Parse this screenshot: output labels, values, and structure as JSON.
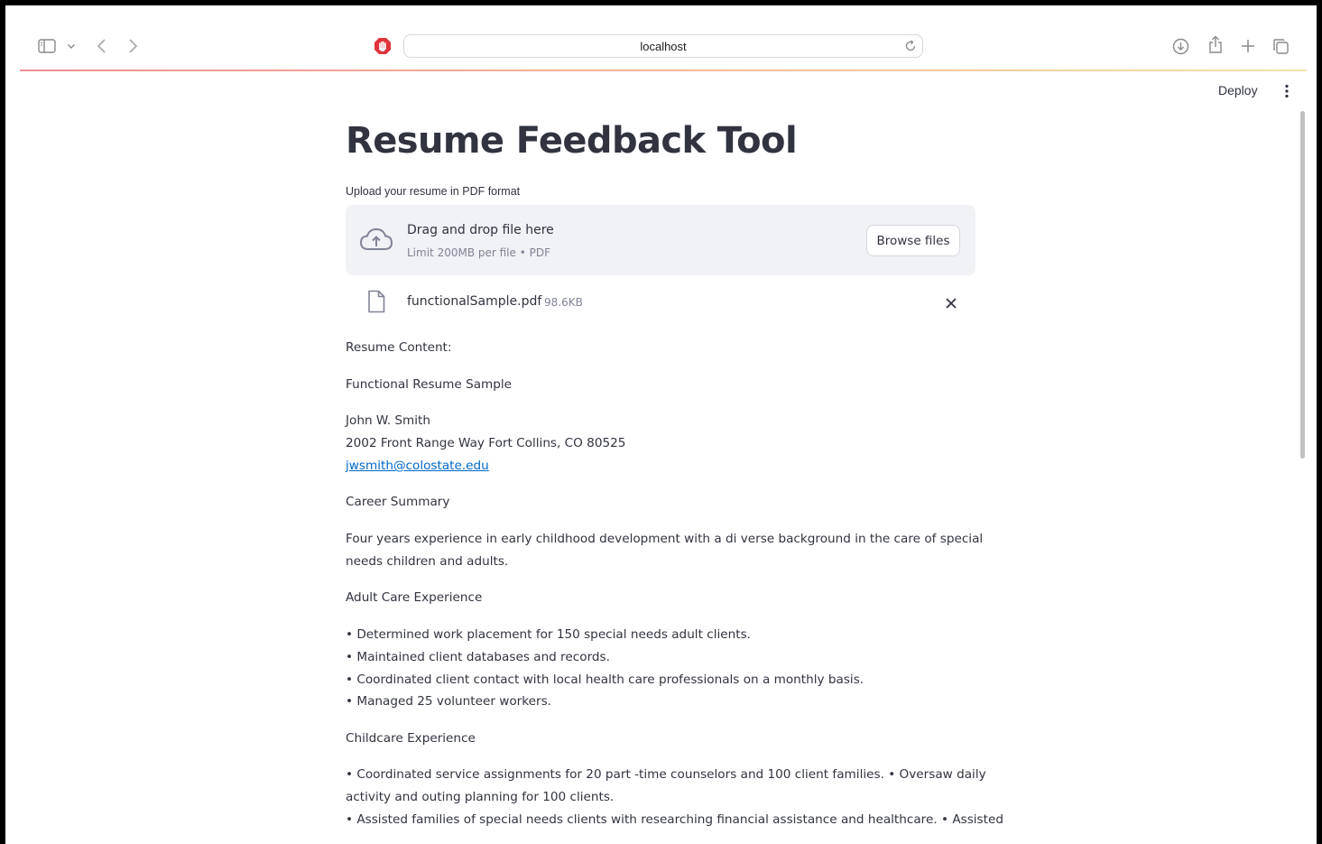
{
  "browser": {
    "url": "localhost",
    "icons": {
      "sidebar": "sidebar-icon",
      "chevron": "chevron-down-icon",
      "back": "back-icon",
      "forward": "forward-icon",
      "extension": "hand-stop-icon",
      "reload": "reload-icon",
      "download": "download-icon",
      "share": "share-icon",
      "new_tab": "plus-icon",
      "tabs": "tabs-overview-icon"
    }
  },
  "header": {
    "deploy_label": "Deploy",
    "menu_icon": "kebab-menu-icon"
  },
  "page": {
    "title": "Resume Feedback Tool",
    "upload_label": "Upload your resume in PDF format",
    "dropzone": {
      "title": "Drag and drop file here",
      "subtitle": "Limit 200MB per file • PDF",
      "browse_label": "Browse files",
      "icon": "cloud-upload-icon"
    },
    "file": {
      "name": "functionalSample.pdf",
      "size": "98.6KB",
      "icon": "file-icon",
      "remove_icon": "close-icon"
    },
    "resume": {
      "heading": "Resume Content:",
      "doc_title": "Functional Resume Sample",
      "name": "John W. Smith",
      "address": "2002 Front Range Way Fort Collins, CO 80525",
      "email": "jwsmith@colostate.edu",
      "career_heading": "Career Summary",
      "career_line1": "Four years experience in early childhood development with a di verse background in the care of special",
      "career_line2": "needs children and adults.",
      "adult_heading": "Adult Care Experience",
      "adult_items": [
        "• Determined work placement for 150 special needs adult clients.",
        "• Maintained client databases and records.",
        "• Coordinated client contact with local health care professionals on a monthly basis.",
        "• Managed 25 volunteer workers."
      ],
      "child_heading": "Childcare Experience",
      "child_line1": "• Coordinated service assignments for 20 part -time counselors and 100 client families. • Oversaw daily",
      "child_line2": "activity and outing planning for 100 clients.",
      "child_line3": "• Assisted families of special needs clients with researching financial assistance and healthcare. • Assisted"
    }
  },
  "colors": {
    "text": "#31333f",
    "muted": "#808495",
    "dropzone_bg": "#f0f2f6",
    "link": "#0068c9",
    "extension_red": "#e0323c"
  }
}
